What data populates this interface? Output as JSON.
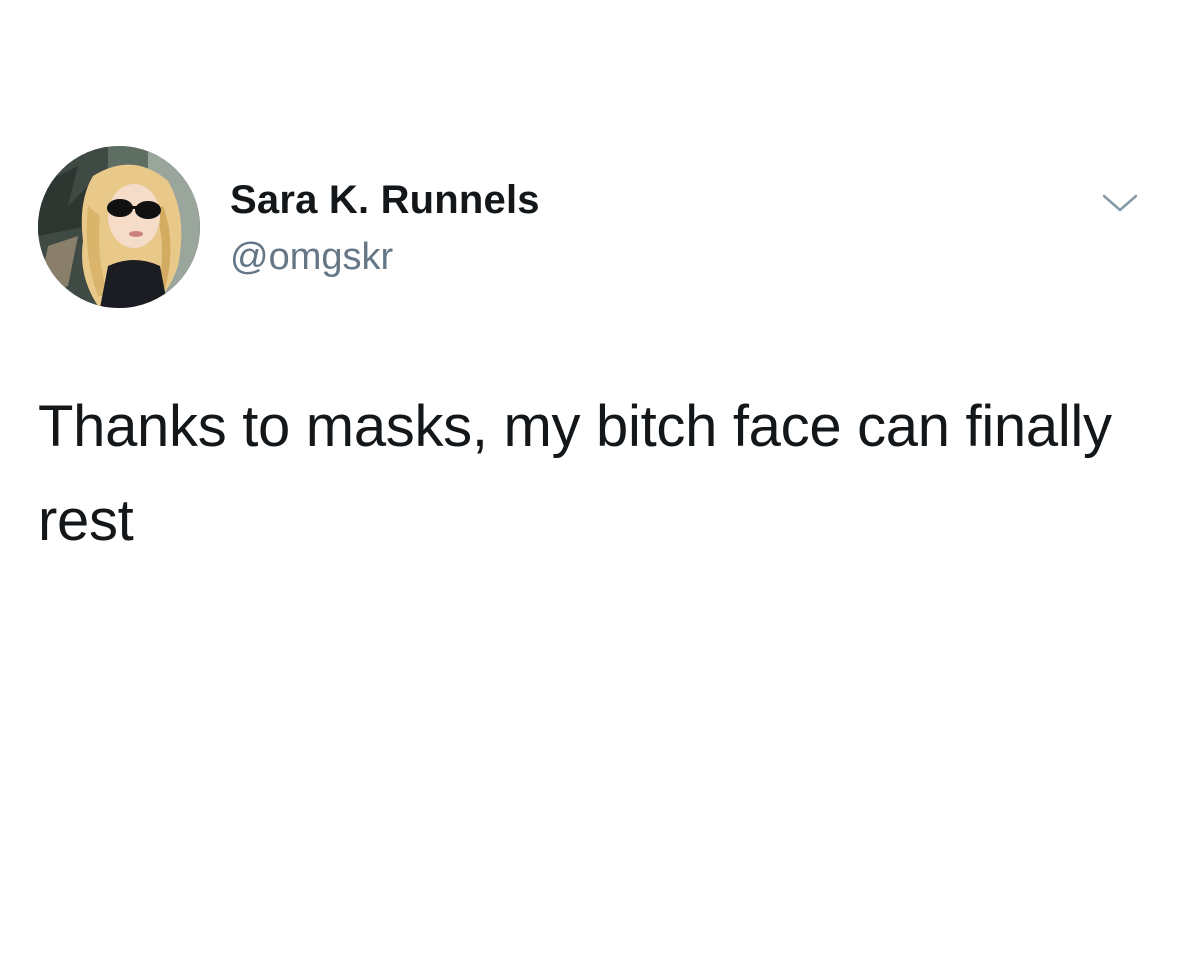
{
  "tweet": {
    "author": {
      "display_name": "Sara K. Runnels",
      "handle": "@omgskr",
      "avatar_icon": "profile-photo-icon"
    },
    "menu_icon": "chevron-down-icon",
    "text": "Thanks to masks, my bitch face can finally rest"
  },
  "colors": {
    "background": "#ffffff",
    "text_primary": "#14171a",
    "text_secondary": "#657786",
    "caret": "#8899a6"
  }
}
